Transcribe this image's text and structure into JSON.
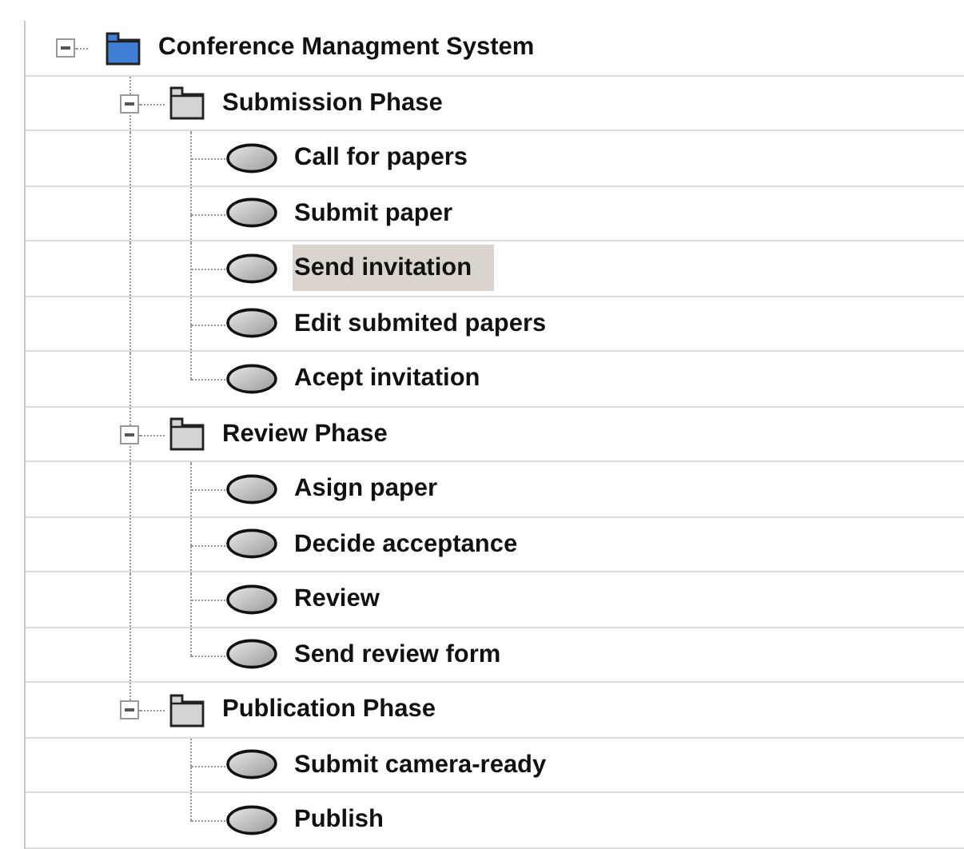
{
  "tree": [
    {
      "label": "Conference Managment System",
      "kind": "root",
      "expanded": true,
      "selected": false,
      "children": [
        {
          "label": "Submission Phase",
          "kind": "folder",
          "expanded": true,
          "selected": false,
          "children": [
            {
              "label": "Call for papers",
              "kind": "usecase",
              "selected": false
            },
            {
              "label": "Submit paper",
              "kind": "usecase",
              "selected": false
            },
            {
              "label": "Send invitation",
              "kind": "usecase",
              "selected": true
            },
            {
              "label": "Edit submited papers",
              "kind": "usecase",
              "selected": false
            },
            {
              "label": "Acept invitation",
              "kind": "usecase",
              "selected": false
            }
          ]
        },
        {
          "label": "Review Phase",
          "kind": "folder",
          "expanded": true,
          "selected": false,
          "children": [
            {
              "label": "Asign paper",
              "kind": "usecase",
              "selected": false
            },
            {
              "label": "Decide acceptance",
              "kind": "usecase",
              "selected": false
            },
            {
              "label": "Review",
              "kind": "usecase",
              "selected": false
            },
            {
              "label": "Send review form",
              "kind": "usecase",
              "selected": false
            }
          ]
        },
        {
          "label": "Publication Phase",
          "kind": "folder",
          "expanded": true,
          "selected": false,
          "children": [
            {
              "label": "Submit camera-ready",
              "kind": "usecase",
              "selected": false
            },
            {
              "label": "Publish",
              "kind": "usecase",
              "selected": false
            }
          ]
        }
      ]
    }
  ]
}
